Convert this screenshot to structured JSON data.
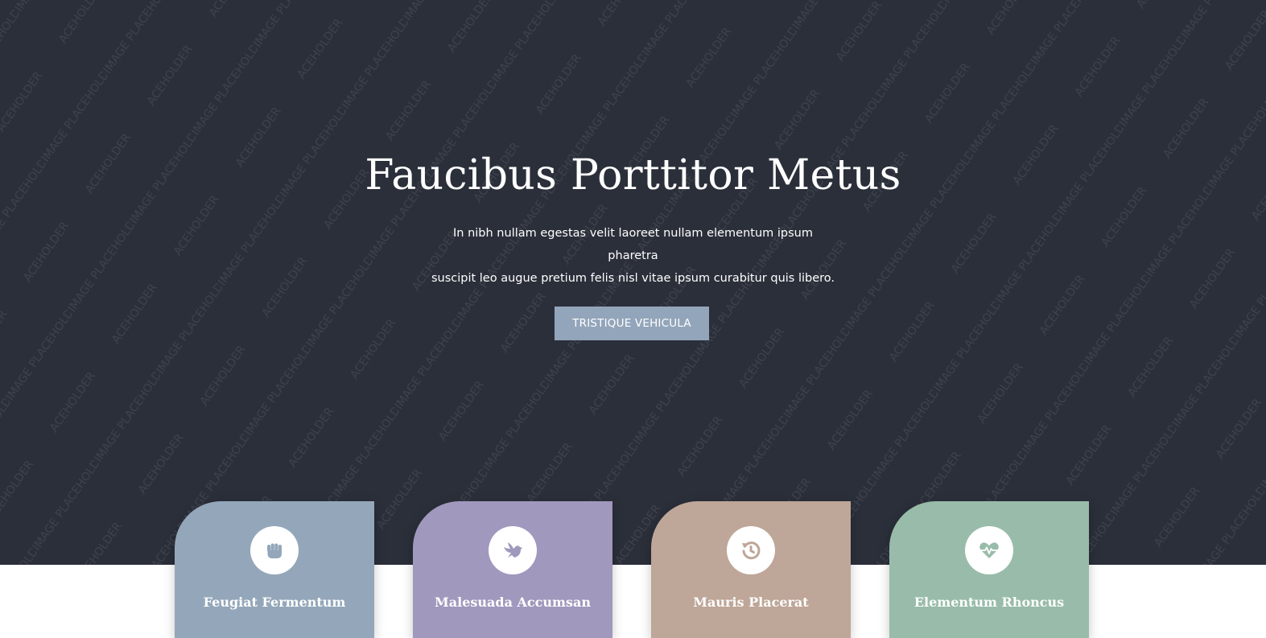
{
  "hero": {
    "title": "Faucibus Porttitor Metus",
    "text_line1": "In nibh nullam egestas velit laoreet nullam elementum ipsum pharetra",
    "text_line2": "suscipit leo augue pretium felis nisl vitae ipsum curabitur quis libero.",
    "button_label": "TRISTIQUE VEHICULA",
    "background_color": "#2b2f3a",
    "button_color": "#93a5ba",
    "watermark_text": "IMAGE PLACEHOLDER"
  },
  "cards": [
    {
      "title": "Feugiat Fermentum",
      "icon": "fist-icon",
      "color": "#94a7ba"
    },
    {
      "title": "Malesuada Accumsan",
      "icon": "dove-icon",
      "color": "#a098bd"
    },
    {
      "title": "Mauris Placerat",
      "icon": "history-icon",
      "color": "#bea698"
    },
    {
      "title": "Elementum Rhoncus",
      "icon": "heartbeat-icon",
      "color": "#98bca9"
    }
  ]
}
